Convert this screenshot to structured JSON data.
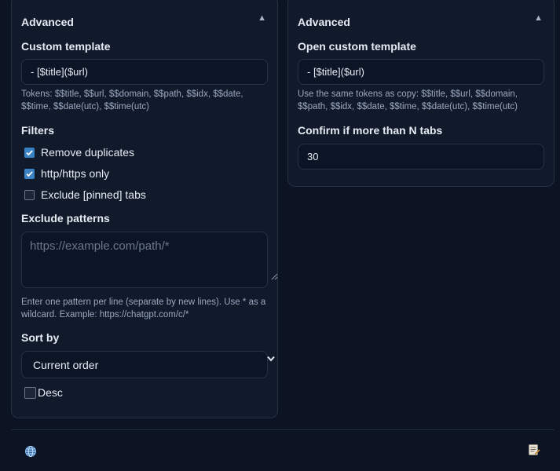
{
  "left_panel": {
    "title": "Advanced",
    "collapse_glyph": "▲",
    "custom_template": {
      "label": "Custom template",
      "value": "- [$title]($url)",
      "hint": "Tokens: $$title, $$url, $$domain, $$path, $$idx, $$date, $$time, $$date(utc), $$time(utc)"
    },
    "filters": {
      "label": "Filters",
      "items": [
        {
          "label": "Remove duplicates",
          "checked": true
        },
        {
          "label": "http/https only",
          "checked": true
        },
        {
          "label": "Exclude [pinned] tabs",
          "checked": false
        }
      ]
    },
    "exclude_patterns": {
      "label": "Exclude patterns",
      "placeholder": "https://example.com/path/*",
      "value": "",
      "hint": "Enter one pattern per line (separate by new lines). Use * as a wildcard. Example: https://chatgpt.com/c/*"
    },
    "sort_by": {
      "label": "Sort by",
      "selected": "Current order"
    },
    "desc": {
      "label": "Desc",
      "checked": false
    }
  },
  "right_panel": {
    "title": "Advanced",
    "collapse_glyph": "▲",
    "open_custom_template": {
      "label": "Open custom template",
      "value": "- [$title]($url)",
      "hint": "Use the same tokens as copy: $$title, $$url, $$domain, $$path, $$idx, $$date, $$time, $$date(utc), $$time(utc)"
    },
    "confirm": {
      "label": "Confirm if more than N tabs",
      "value": "30"
    }
  },
  "footer": {
    "left_icon": "globe-icon",
    "right_icon": "notepad-icon"
  },
  "colors": {
    "background": "#0c1424",
    "panel": "#111a2b",
    "border": "#243046",
    "accent": "#3b82c4",
    "hint_text": "#9aa8bf"
  }
}
